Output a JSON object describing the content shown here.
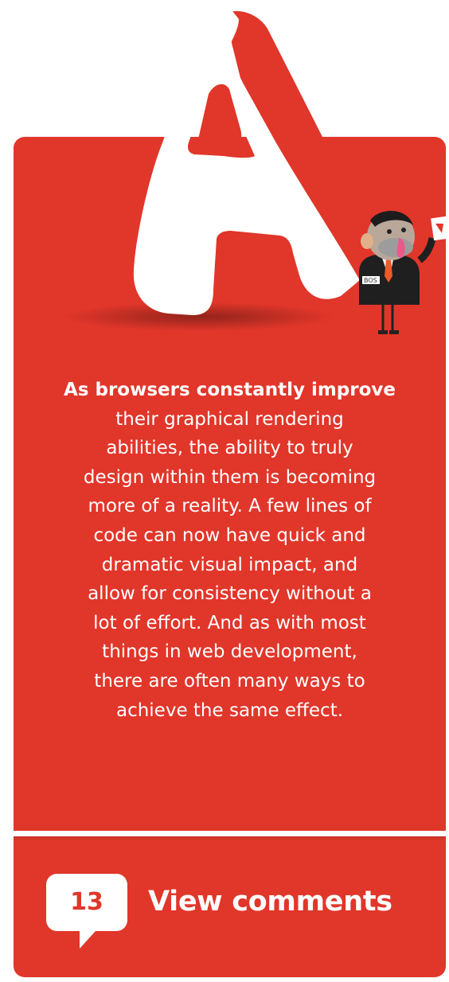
{
  "article": {
    "intro_bold": "As browsers constantly improve",
    "intro_rest": "their graphical rendering abilities, the ability to truly design within them is becoming more of a reality. A few lines of code can now have quick and dramatic visual impact, and allow for consistency without a lot of effort. And as with most things in web development, there are often many ways to achieve the same effect.",
    "intro_lines": [
      "their graphical rendering",
      "abilities, the ability to truly",
      "design within them is becoming",
      "more of a reality. A few lines of",
      "code can now have quick and",
      "dramatic visual impact, and",
      "allow for consistency without a",
      "lot of effort. And as with most",
      "things in web development,",
      "there are often many ways to",
      "achieve the same effect."
    ]
  },
  "comments": {
    "count": "13",
    "label": "View comments"
  },
  "mascot": {
    "badge_text": "BOS"
  },
  "colors": {
    "brand_red": "#e1362a",
    "white": "#ffffff"
  }
}
